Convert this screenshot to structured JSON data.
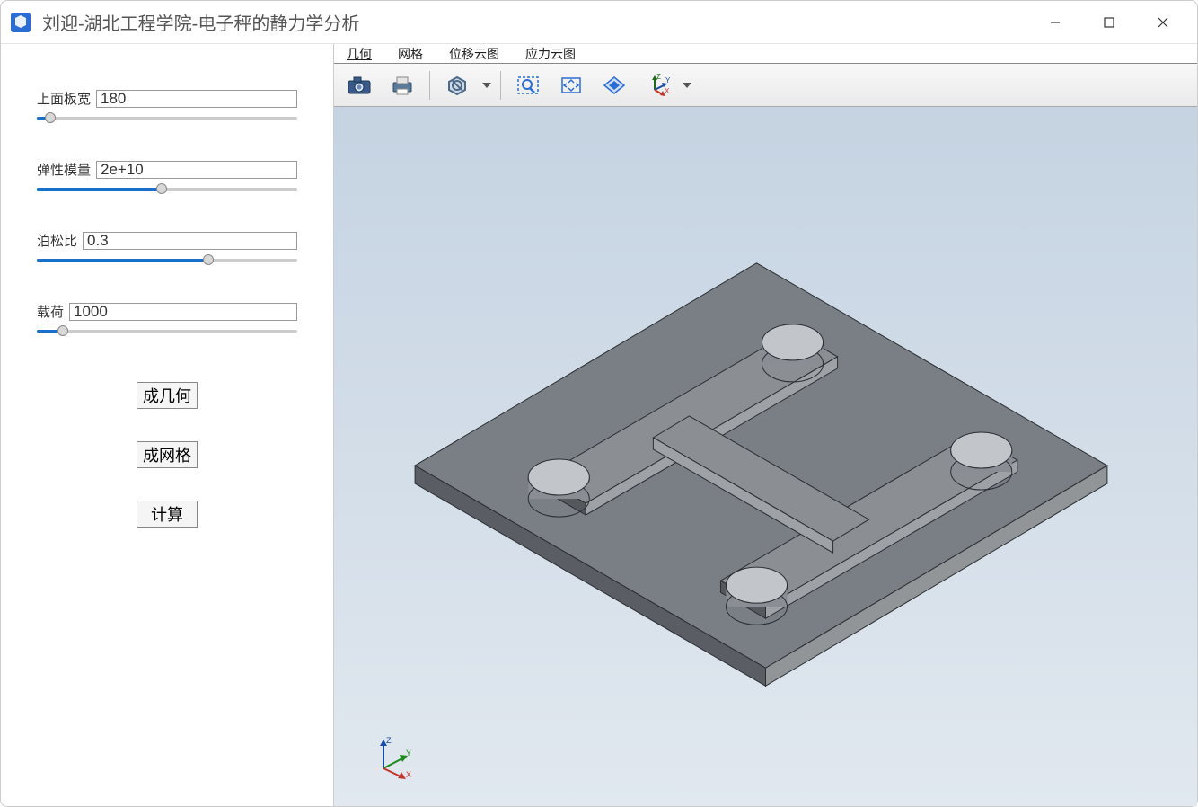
{
  "window": {
    "title": "刘迎-湖北工程学院-电子秤的静力学分析"
  },
  "params": {
    "top_plate_width": {
      "label": "上面板宽",
      "value": "180",
      "fill": 5
    },
    "elastic_modulus": {
      "label": "弹性模量",
      "value": "2e+10",
      "fill": 48
    },
    "poisson_ratio": {
      "label": "泊松比",
      "value": "0.3",
      "fill": 66
    },
    "load": {
      "label": "载荷",
      "value": "1000",
      "fill": 10
    }
  },
  "buttons": {
    "gen_geometry": "成几何",
    "gen_mesh": "成网格",
    "calculate": "计算"
  },
  "tabs": {
    "geometry": "几何",
    "mesh": "网格",
    "displacement": "位移云图",
    "stress": "应力云图"
  },
  "toolbar_icons": {
    "camera": "camera",
    "print": "print",
    "shade": "shade-mode",
    "zoom_area": "zoom-area",
    "fit": "fit-view",
    "perspective": "perspective",
    "axes": "axes-orientation"
  },
  "axes": {
    "x": "X",
    "y": "Y",
    "z": "Z"
  }
}
